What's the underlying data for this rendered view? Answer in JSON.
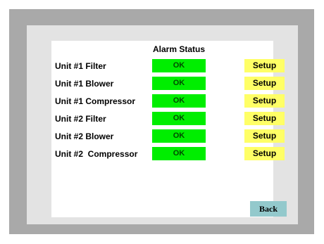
{
  "screen": {
    "header": "Alarm Status",
    "rows": [
      {
        "label": "Unit #1 Filter",
        "status": "OK",
        "setup": "Setup"
      },
      {
        "label": "Unit #1 Blower",
        "status": "OK",
        "setup": "Setup"
      },
      {
        "label": "Unit #1 Compressor",
        "status": "OK",
        "setup": "Setup"
      },
      {
        "label": "Unit #2 Filter",
        "status": "OK",
        "setup": "Setup"
      },
      {
        "label": "Unit #2 Blower",
        "status": "OK",
        "setup": "Setup"
      },
      {
        "label": "Unit #2  Compressor",
        "status": "OK",
        "setup": "Setup"
      }
    ],
    "back_label": "Back"
  },
  "colors": {
    "ok_indicator": "#00ee00",
    "setup_button": "#ffff66",
    "back_button": "#93c9cc",
    "outer_frame": "#a9a9a9",
    "bezel": "#e3e3e3"
  }
}
